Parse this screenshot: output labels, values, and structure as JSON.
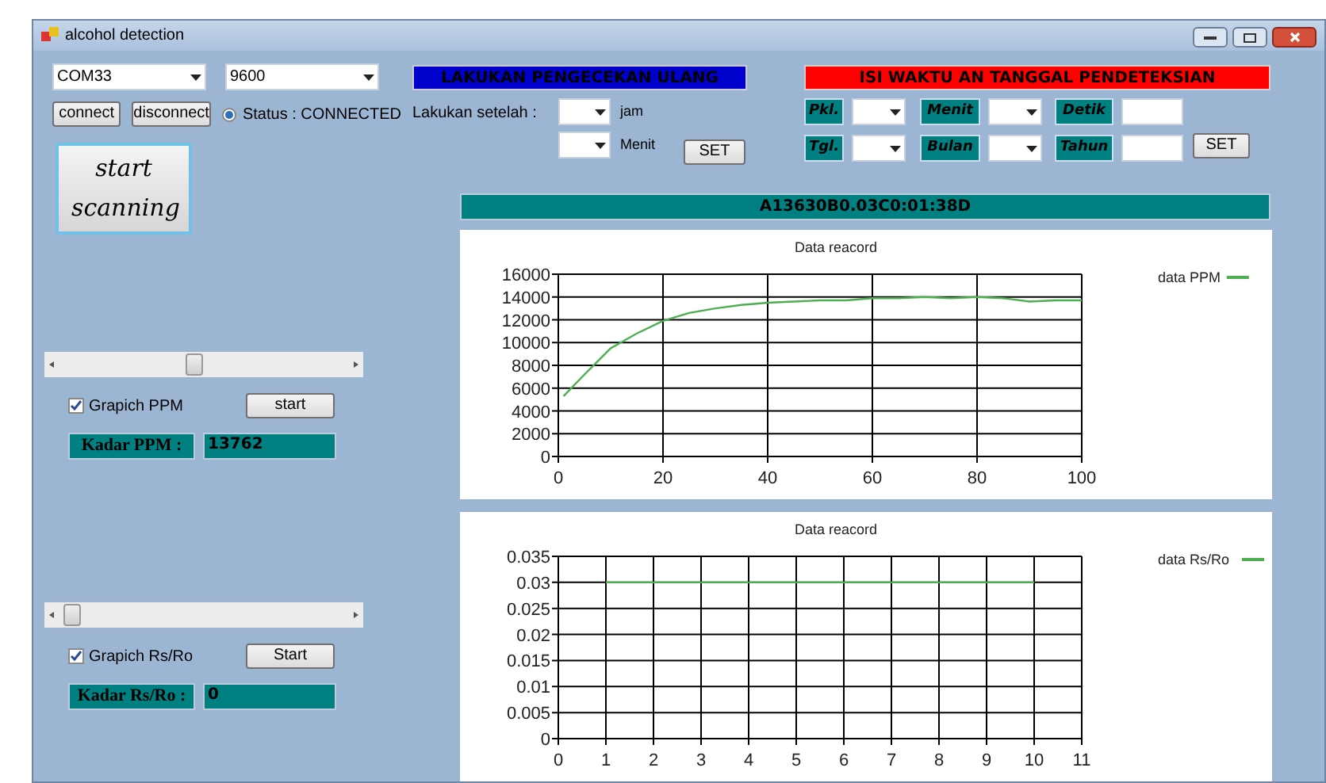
{
  "window": {
    "title": "alcohol detection"
  },
  "connection": {
    "port": "COM33",
    "baud": "9600",
    "buttons": [
      "connect",
      "disconnect"
    ],
    "status": {
      "label": "Status : CONNECTED",
      "on": true
    }
  },
  "start_scan_button": "start scanning",
  "recheck": {
    "header": "LAKUKAN PENGECEKAN ULANG",
    "label": "Lakukan setelah :",
    "units": [
      "jam",
      "Menit"
    ],
    "button": "SET"
  },
  "schedule": {
    "header": "ISI WAKTU AN TANGGAL PENDETEKSIAN",
    "fields": [
      {
        "label": "Pkl.",
        "kind": "combo"
      },
      {
        "label": "Menit",
        "kind": "combo"
      },
      {
        "label": "Detik",
        "kind": "text"
      },
      {
        "label": "Tgl.",
        "kind": "combo"
      },
      {
        "label": "Bulan",
        "kind": "combo"
      },
      {
        "label": "Tahun",
        "kind": "text"
      }
    ],
    "button": "SET"
  },
  "data_bar": "A13630B0.03C0:01:38D",
  "panels": [
    {
      "checkbox": {
        "label": "Grapich PPM",
        "checked": true
      },
      "button": "start",
      "readout_label": "Kadar PPM :",
      "readout_value": "13762",
      "chart_data": {
        "type": "line",
        "title": "Data reacord",
        "x": [
          1,
          5,
          10,
          15,
          20,
          25,
          30,
          35,
          40,
          45,
          50,
          55,
          60,
          65,
          70,
          75,
          80,
          85,
          90,
          95,
          100
        ],
        "series": [
          {
            "name": "data PPM",
            "color": "#4caf50",
            "values": [
              5300,
              7200,
              9500,
              10800,
              11900,
              12600,
              13000,
              13300,
              13500,
              13600,
              13700,
              13700,
              13900,
              13900,
              14000,
              13900,
              14000,
              13900,
              13600,
              13700,
              13700
            ]
          }
        ],
        "grid": true,
        "xlim": [
          0,
          100
        ],
        "ylim": [
          0,
          16000
        ],
        "xticks": [
          0,
          20,
          40,
          60,
          80,
          100
        ],
        "yticks": [
          0,
          2000,
          4000,
          6000,
          8000,
          10000,
          12000,
          14000,
          16000
        ]
      }
    },
    {
      "checkbox": {
        "label": "Grapich Rs/Ro",
        "checked": true
      },
      "button": "Start",
      "readout_label": "Kadar Rs/Ro :",
      "readout_value": "0",
      "chart_data": {
        "type": "line",
        "title": "Data reacord",
        "x": [
          1,
          2,
          3,
          4,
          5,
          6,
          7,
          8,
          9,
          10
        ],
        "series": [
          {
            "name": "data Rs/Ro",
            "color": "#4caf50",
            "values": [
              0.03,
              0.03,
              0.03,
              0.03,
              0.03,
              0.03,
              0.03,
              0.03,
              0.03,
              0.03
            ]
          }
        ],
        "grid": true,
        "xlim": [
          0,
          11
        ],
        "ylim": [
          0,
          0.035
        ],
        "xticks": [
          0,
          1,
          2,
          3,
          4,
          5,
          6,
          7,
          8,
          9,
          10,
          11
        ],
        "yticks": [
          0,
          0.005,
          0.01,
          0.015,
          0.02,
          0.025,
          0.03,
          0.035
        ]
      }
    }
  ]
}
